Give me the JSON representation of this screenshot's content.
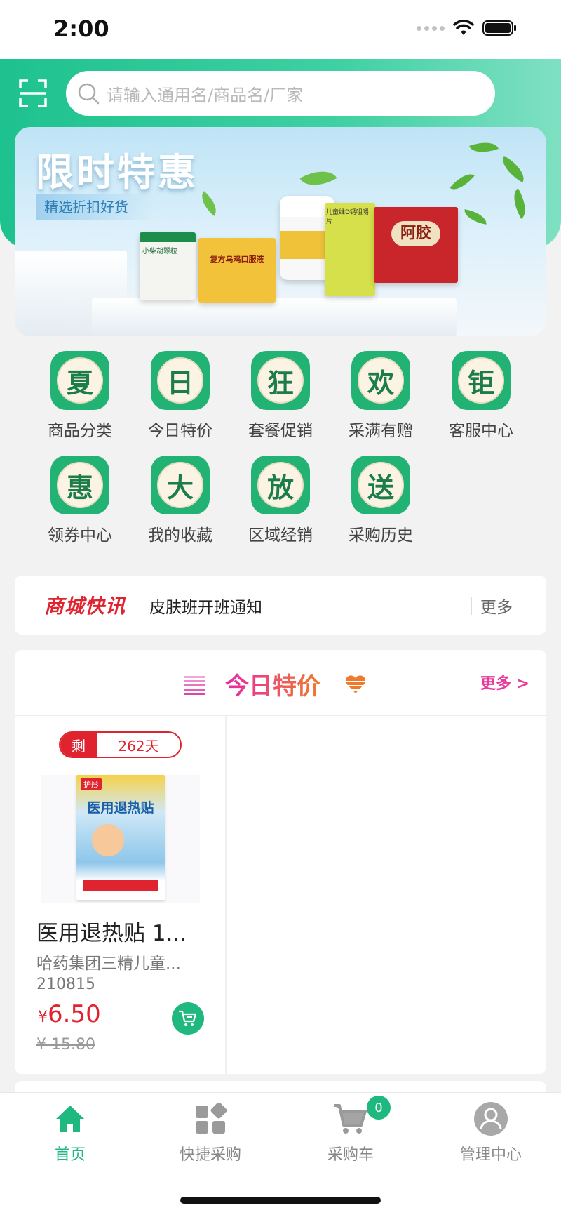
{
  "status_bar": {
    "time": "2:00"
  },
  "search": {
    "placeholder": "请输入通用名/商品名/厂家"
  },
  "banner": {
    "title": "限时特惠",
    "subtitle": "精选折扣好货",
    "boxes": [
      "小柴胡颗粒",
      "复方乌鸡口服液",
      "儿童维D钙咀嚼片",
      "儿童维D钙咀嚼片",
      "阿胶"
    ]
  },
  "menu": [
    {
      "glyph": "夏",
      "label": "商品分类"
    },
    {
      "glyph": "日",
      "label": "今日特价"
    },
    {
      "glyph": "狂",
      "label": "套餐促销"
    },
    {
      "glyph": "欢",
      "label": "采满有赠"
    },
    {
      "glyph": "钜",
      "label": "客服中心"
    },
    {
      "glyph": "惠",
      "label": "领券中心"
    },
    {
      "glyph": "大",
      "label": "我的收藏"
    },
    {
      "glyph": "放",
      "label": "区域经销"
    },
    {
      "glyph": "送",
      "label": "采购历史"
    }
  ],
  "news": {
    "brand": "商城快讯",
    "text": "皮肤班开班通知",
    "more": "更多"
  },
  "special": {
    "title": "今日特价",
    "more": "更多 >",
    "product": {
      "remain_label": "剩",
      "remain_days": "262天",
      "image_brand": "护彤",
      "image_title": "医用退热贴",
      "name": "医用退热贴 1...",
      "maker": "哈药集团三精儿童...",
      "batch": "210815",
      "currency": "¥",
      "price": "6.50",
      "old_price": "¥ 15.80"
    }
  },
  "tabbar": {
    "home": "首页",
    "quick": "快捷采购",
    "cart": "采购车",
    "cart_count": "0",
    "manage": "管理中心"
  },
  "colors": {
    "brand_green": "#1fb87f",
    "price_red": "#e0242f",
    "special_pink": "#e83a9a"
  }
}
